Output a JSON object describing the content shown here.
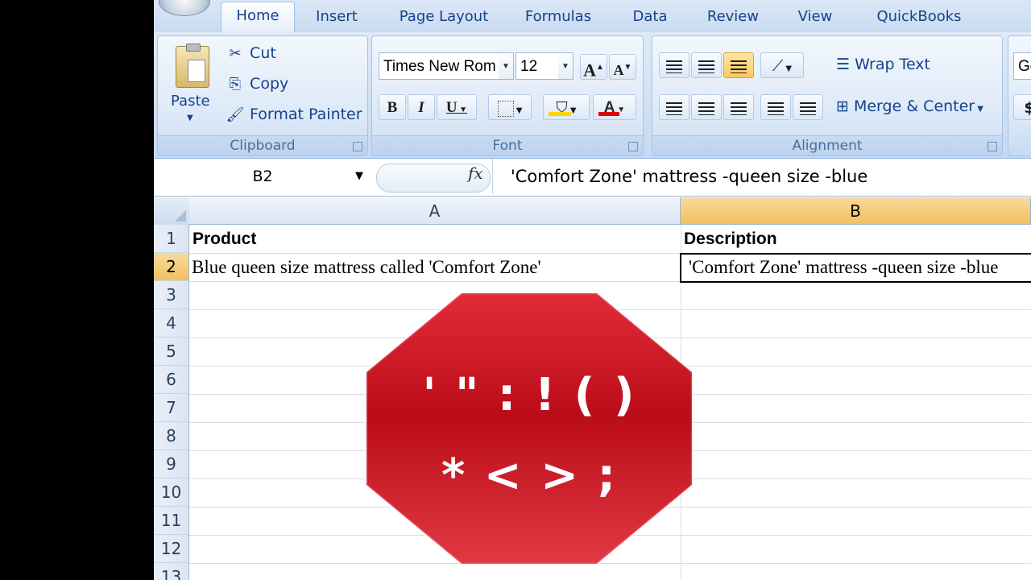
{
  "tabs": [
    "Home",
    "Insert",
    "Page Layout",
    "Formulas",
    "Data",
    "Review",
    "View",
    "QuickBooks"
  ],
  "clipboard": {
    "paste": "Paste",
    "cut": "Cut",
    "copy": "Copy",
    "format_painter": "Format Painter",
    "label": "Clipboard"
  },
  "font": {
    "name": "Times New Rom",
    "size": "12",
    "grow": "A",
    "shrink": "A",
    "bold": "B",
    "italic": "I",
    "underline": "U",
    "font_color_letter": "A",
    "label": "Font"
  },
  "alignment": {
    "wrap_text": "Wrap Text",
    "merge_center": "Merge & Center",
    "label": "Alignment"
  },
  "number": {
    "format_partial": "Ge",
    "currency_partial": "$"
  },
  "formula_bar": {
    "name_box": "B2",
    "fx": "fx",
    "content": "'Comfort Zone' mattress -queen size -blue"
  },
  "grid": {
    "columns": [
      "A",
      "B"
    ],
    "rows": [
      "1",
      "2",
      "3",
      "4",
      "5",
      "6",
      "7",
      "8",
      "9",
      "10",
      "11",
      "12",
      "13"
    ],
    "cells": {
      "A1": "Product",
      "B1": "Description",
      "A2": "Blue queen size mattress called 'Comfort Zone'",
      "B2": "'Comfort Zone' mattress -queen size -blue"
    }
  },
  "stop_sign": {
    "line1": "' \" : ! ( )",
    "line2": "* < > ;",
    "color": "#c8101e"
  }
}
